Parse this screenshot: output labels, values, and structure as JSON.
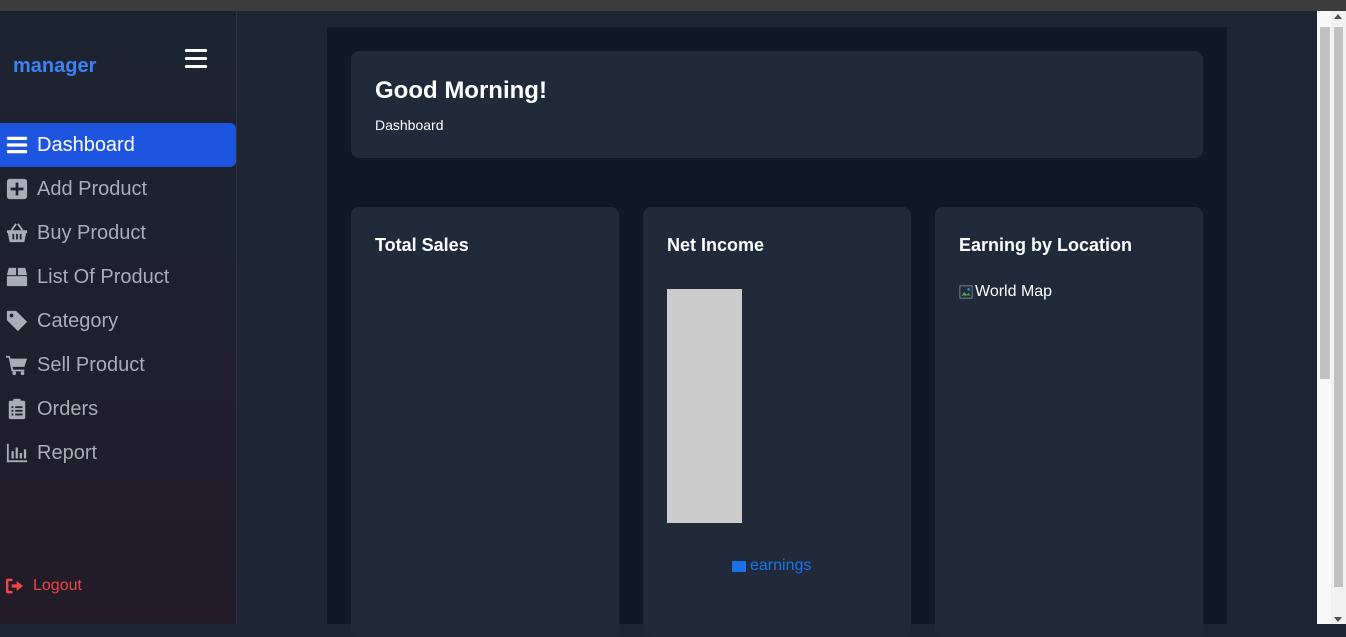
{
  "sidebar": {
    "brand": "manager",
    "items": [
      {
        "label": "Dashboard",
        "icon": "list-icon",
        "active": true
      },
      {
        "label": "Add Product",
        "icon": "plus-square-icon"
      },
      {
        "label": "Buy Product",
        "icon": "basket-icon"
      },
      {
        "label": "List Of Product",
        "icon": "box-icon"
      },
      {
        "label": "Category",
        "icon": "tag-icon"
      },
      {
        "label": "Sell Product",
        "icon": "cart-icon"
      },
      {
        "label": "Orders",
        "icon": "clipboard-icon"
      },
      {
        "label": "Report",
        "icon": "bar-chart-icon"
      }
    ],
    "logout_label": "Logout"
  },
  "header": {
    "greeting": "Good Morning!",
    "breadcrumb": "Dashboard"
  },
  "cards": {
    "total_sales": {
      "title": "Total Sales"
    },
    "net_income": {
      "title": "Net Income",
      "legend": "earnings"
    },
    "earning_by_location": {
      "title": "Earning by Location",
      "image_alt": "World Map"
    }
  },
  "colors": {
    "accent": "#1e55e0",
    "brand": "#3b82f6",
    "legend": "#1a73e8",
    "logout": "#ef4444",
    "bar": "#cccccc"
  },
  "chart_data": {
    "type": "bar",
    "categories": [
      ""
    ],
    "series": [
      {
        "name": "earnings",
        "values": [
          1
        ]
      }
    ],
    "ylim": [
      0,
      1
    ],
    "legend": "bottom"
  }
}
